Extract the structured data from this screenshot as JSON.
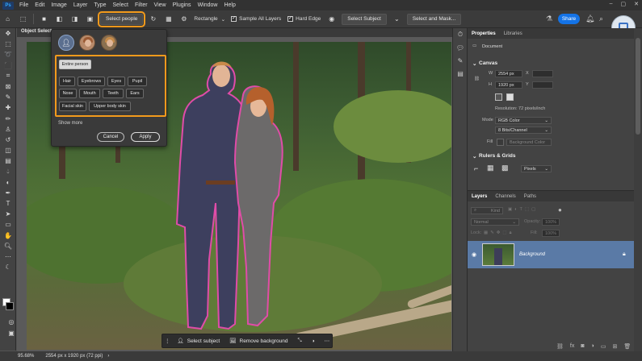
{
  "menubar": {
    "logo": "Ps",
    "items": [
      "File",
      "Edit",
      "Image",
      "Layer",
      "Type",
      "Select",
      "Filter",
      "View",
      "Plugins",
      "Window",
      "Help"
    ]
  },
  "optionsbar": {
    "select_people": "Select people",
    "mode": "Rectangle",
    "sample_all_layers": "Sample All Layers",
    "hard_edge": "Hard Edge",
    "select_subject": "Select Subject",
    "select_and_mask": "Select and Mask...",
    "share": "Share"
  },
  "document": {
    "tab_title": "Object Select"
  },
  "popover": {
    "entire_person": "Entire person",
    "parts": [
      "Hair",
      "Eyebrows",
      "Eyes",
      "Pupil",
      "Nose",
      "Mouth",
      "Teeth",
      "Ears",
      "Facial skin",
      "Upper body skin"
    ],
    "show_more": "Show more",
    "cancel": "Cancel",
    "apply": "Apply"
  },
  "taskbar": {
    "select_subject": "Select subject",
    "remove_background": "Remove background"
  },
  "status": {
    "zoom": "95.68%",
    "doc_info": "2554 px x 1920 px (72 ppi)"
  },
  "properties": {
    "tabs": [
      "Properties",
      "Libraries"
    ],
    "document_label": "Document",
    "canvas_heading": "Canvas",
    "w_label": "W",
    "w_value": "2554 px",
    "h_label": "H",
    "h_value": "1920 px",
    "x_label": "X",
    "y_label": "Y",
    "resolution": "Resolution: 72 pixels/inch",
    "mode_label": "Mode",
    "mode_value": "RGB Color",
    "depth_value": "8 Bits/Channel",
    "fill_label": "Fill",
    "fill_value": "Background Color",
    "rulers_heading": "Rulers & Grids",
    "units_value": "Pixels"
  },
  "layers": {
    "tabs": [
      "Layers",
      "Channels",
      "Paths"
    ],
    "kind_label": "Kind",
    "blend_mode": "Normal",
    "opacity_label": "Opacity:",
    "opacity_value": "100%",
    "lock_label": "Lock:",
    "fill_label": "Fill:",
    "fill_value": "100%",
    "layer_name": "Background"
  },
  "colors": {
    "accent": "#f29a1c",
    "share": "#1473e6",
    "selection": "#e04ca8",
    "layer_selected": "#5a7aa6"
  }
}
